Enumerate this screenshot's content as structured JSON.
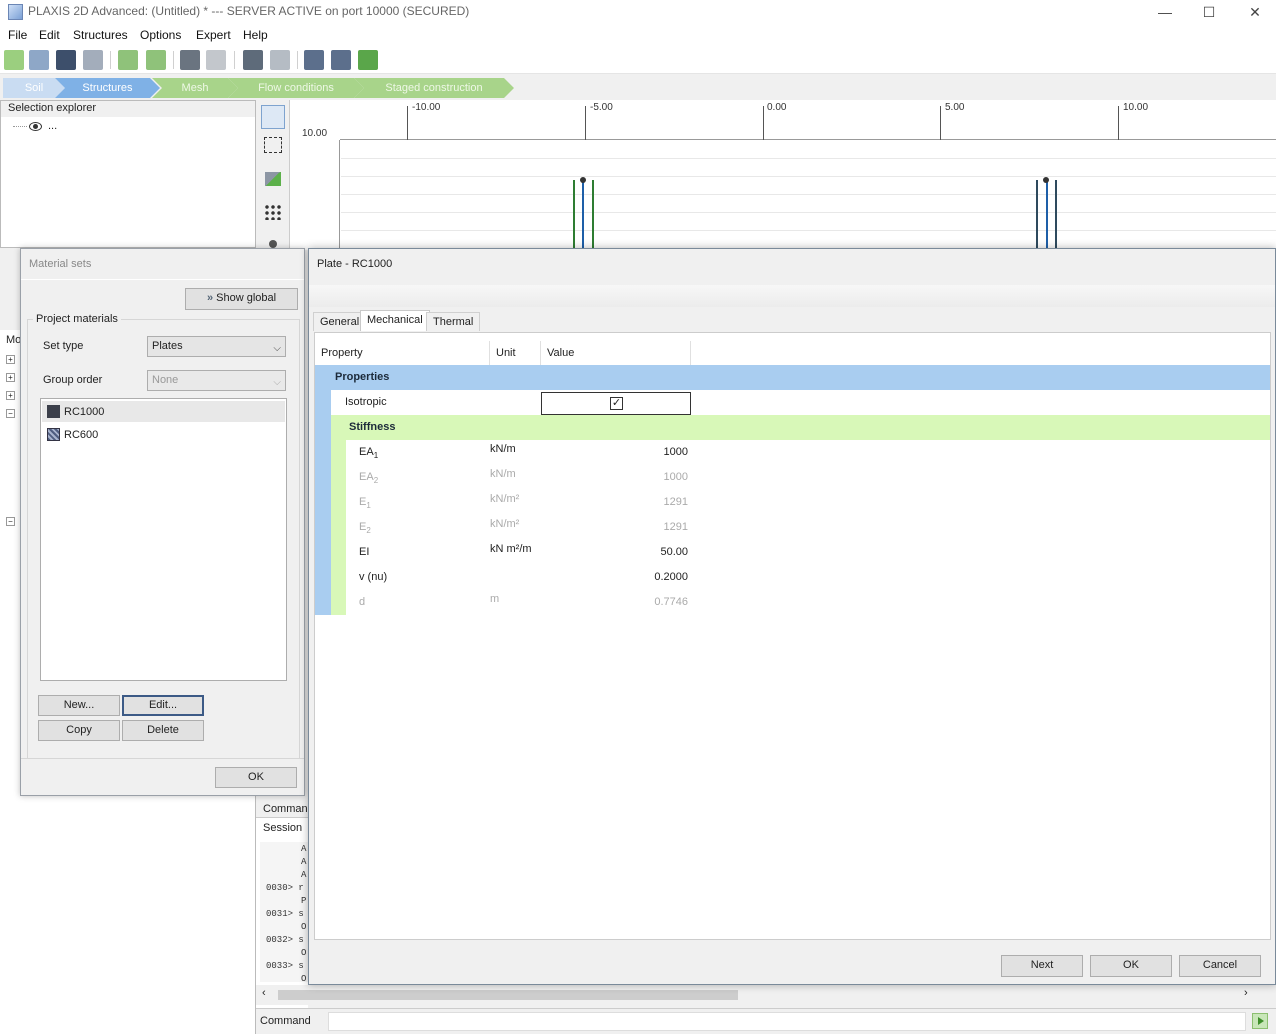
{
  "window": {
    "title": "PLAXIS 2D Advanced: (Untitled) * --- SERVER ACTIVE on port 10000 (SECURED)",
    "minimize": "—",
    "maximize": "☐",
    "close": "✕"
  },
  "menu": [
    "File",
    "Edit",
    "Structures",
    "Options",
    "Expert",
    "Help"
  ],
  "phases": [
    "Soil",
    "Structures",
    "Mesh",
    "Flow conditions",
    "Staged construction"
  ],
  "selection_explorer": {
    "title": "Selection explorer",
    "root": "..."
  },
  "left_lower": {
    "label": "Mo"
  },
  "ruler": {
    "y_label": "10.00",
    "x_labels": [
      "-10.00",
      "-5.00",
      "0.00",
      "5.00",
      "10.00"
    ]
  },
  "material_sets": {
    "title": "Material sets",
    "show_global": "Show global",
    "group_title": "Project materials",
    "set_type_label": "Set type",
    "set_type_value": "Plates",
    "group_order_label": "Group order",
    "group_order_value": "None",
    "materials": [
      {
        "name": "RC1000",
        "color": "#3b3f4a"
      },
      {
        "name": "RC600",
        "color": "#6c7a9c"
      }
    ],
    "buttons": {
      "new": "New...",
      "edit": "Edit...",
      "copy": "Copy",
      "delete": "Delete",
      "ok": "OK"
    }
  },
  "plate": {
    "title": "Plate - RC1000",
    "tabs": [
      "General",
      "Mechanical",
      "Thermal"
    ],
    "columns": [
      "Property",
      "Unit",
      "Value"
    ],
    "properties_header": "Properties",
    "isotropic_label": "Isotropic",
    "isotropic_checked": true,
    "stiffness_header": "Stiffness",
    "rows": [
      {
        "prop": "EA",
        "sub": "1",
        "unit": "kN/m",
        "value": "1000",
        "enabled": true
      },
      {
        "prop": "EA",
        "sub": "2",
        "unit": "kN/m",
        "value": "1000",
        "enabled": false
      },
      {
        "prop": "E",
        "sub": "1",
        "unit": "kN/m²",
        "value": "1291",
        "enabled": false
      },
      {
        "prop": "E",
        "sub": "2",
        "unit": "kN/m²",
        "value": "1291",
        "enabled": false
      },
      {
        "prop": "EI",
        "sub": "",
        "unit": "kN m²/m",
        "value": "50.00",
        "enabled": true
      },
      {
        "prop": "v (nu)",
        "sub": "",
        "unit": "",
        "value": "0.2000",
        "enabled": true
      },
      {
        "prop": "d",
        "sub": "",
        "unit": "m",
        "value": "0.7746",
        "enabled": false
      }
    ],
    "buttons": {
      "next": "Next",
      "ok": "OK",
      "cancel": "Cancel"
    }
  },
  "console": {
    "tab_commands": "Comman",
    "session": "Session",
    "lines": [
      "0030> r",
      "0031> s",
      "0032> s",
      "0033> s"
    ],
    "fragments": [
      "A",
      "A",
      "A",
      "P",
      "O",
      "O",
      "O",
      "O"
    ]
  },
  "command_bar": {
    "label": "Command"
  },
  "colors": {
    "properties_band": "#a9cdf0",
    "stiffness_band": "#d8f8b8",
    "phase_bg": "#a8d48a"
  }
}
